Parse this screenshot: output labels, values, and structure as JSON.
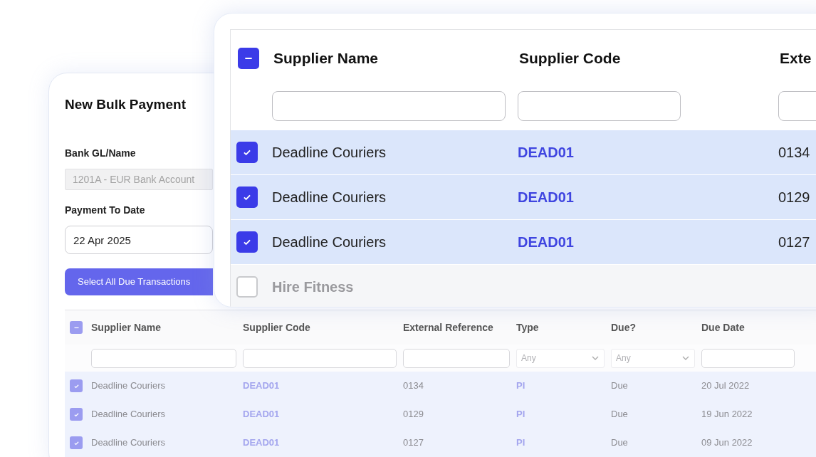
{
  "form": {
    "title": "New Bulk Payment",
    "fields": [
      {
        "label": "Bank GL/Name",
        "value": "1201A - EUR Bank Account",
        "disabled": true
      },
      {
        "label": "Payment To Date",
        "value": "22 Apr 2025",
        "disabled": false
      }
    ],
    "button": "Select All Due Transactions"
  },
  "table": {
    "select_all": {
      "indeterminate": true
    },
    "columns": [
      {
        "label": "Supplier Name",
        "filter": {
          "kind": "text"
        }
      },
      {
        "label": "Supplier Code",
        "filter": {
          "kind": "text"
        }
      },
      {
        "label": "External Reference",
        "filter": {
          "kind": "text"
        }
      },
      {
        "label": "Type",
        "filter": {
          "kind": "select",
          "placeholder": "Any"
        }
      },
      {
        "label": "Due?",
        "filter": {
          "kind": "select",
          "placeholder": "Any"
        }
      },
      {
        "label": "Due Date",
        "filter": {
          "kind": "text"
        }
      }
    ],
    "rows": [
      {
        "checked": true,
        "cells": [
          "Deadline Couriers",
          "DEAD01",
          "0134",
          "PI",
          "Due",
          "20 Jul 2022"
        ]
      },
      {
        "checked": true,
        "cells": [
          "Deadline Couriers",
          "DEAD01",
          "0129",
          "PI",
          "Due",
          "19 Jun 2022"
        ]
      },
      {
        "checked": true,
        "cells": [
          "Deadline Couriers",
          "DEAD01",
          "0127",
          "PI",
          "Due",
          "09 Jun 2022"
        ]
      }
    ]
  },
  "zoom_table": {
    "select_all": {
      "indeterminate": true
    },
    "columns": [
      "Supplier Name",
      "Supplier Code",
      "Exte"
    ],
    "rows": [
      {
        "checked": true,
        "cells": [
          "Deadline Couriers",
          "DEAD01",
          "0134"
        ]
      },
      {
        "checked": true,
        "cells": [
          "Deadline Couriers",
          "DEAD01",
          "0129"
        ]
      },
      {
        "checked": true,
        "cells": [
          "Deadline Couriers",
          "DEAD01",
          "0127"
        ]
      },
      {
        "checked": false,
        "cells": [
          "Hire Fitness"
        ]
      }
    ]
  }
}
